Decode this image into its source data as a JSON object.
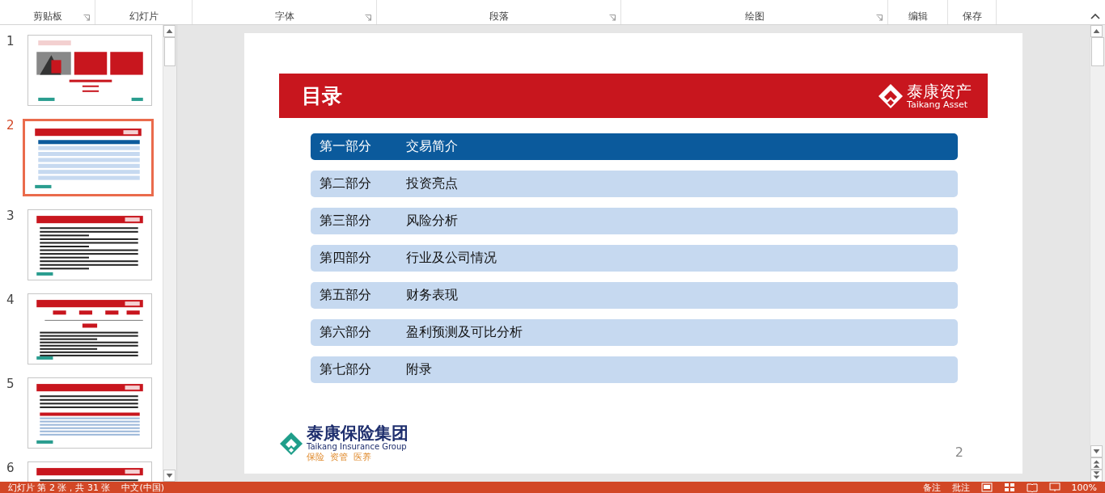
{
  "ribbon": {
    "groups": [
      {
        "label": "剪贴板",
        "launcher": true
      },
      {
        "label": "幻灯片",
        "launcher": false
      },
      {
        "label": "字体",
        "launcher": true
      },
      {
        "label": "段落",
        "launcher": true
      },
      {
        "label": "绘图",
        "launcher": true
      },
      {
        "label": "编辑",
        "launcher": false
      },
      {
        "label": "保存",
        "launcher": false
      }
    ]
  },
  "thumbnails": [
    {
      "number": "1",
      "selected": false,
      "kind": "title"
    },
    {
      "number": "2",
      "selected": true,
      "kind": "toc"
    },
    {
      "number": "3",
      "selected": false,
      "kind": "bullets"
    },
    {
      "number": "4",
      "selected": false,
      "kind": "org"
    },
    {
      "number": "5",
      "selected": false,
      "kind": "table"
    },
    {
      "number": "6",
      "selected": false,
      "kind": "bullets"
    }
  ],
  "slide": {
    "header": {
      "title": "目录",
      "logo_cn": "泰康资产",
      "logo_en": "Taikang Asset"
    },
    "sections": [
      {
        "part": "第一部分",
        "title": "交易简介",
        "selected": true
      },
      {
        "part": "第二部分",
        "title": "投资亮点",
        "selected": false
      },
      {
        "part": "第三部分",
        "title": "风险分析",
        "selected": false
      },
      {
        "part": "第四部分",
        "title": "行业及公司情况",
        "selected": false
      },
      {
        "part": "第五部分",
        "title": "财务表现",
        "selected": false
      },
      {
        "part": "第六部分",
        "title": "盈利预测及可比分析",
        "selected": false
      },
      {
        "part": "第七部分",
        "title": "附录",
        "selected": false
      }
    ],
    "footer_logo": {
      "cn": "泰康保险集团",
      "en": "Taikang Insurance Group",
      "tagline": "保险  资管  医养"
    },
    "page_number": "2"
  },
  "status_bar": {
    "slide_info": "幻灯片 第 2 张，共 31 张",
    "language": "中文(中国)",
    "notes": "备注",
    "comments": "批注",
    "zoom": "100%"
  }
}
